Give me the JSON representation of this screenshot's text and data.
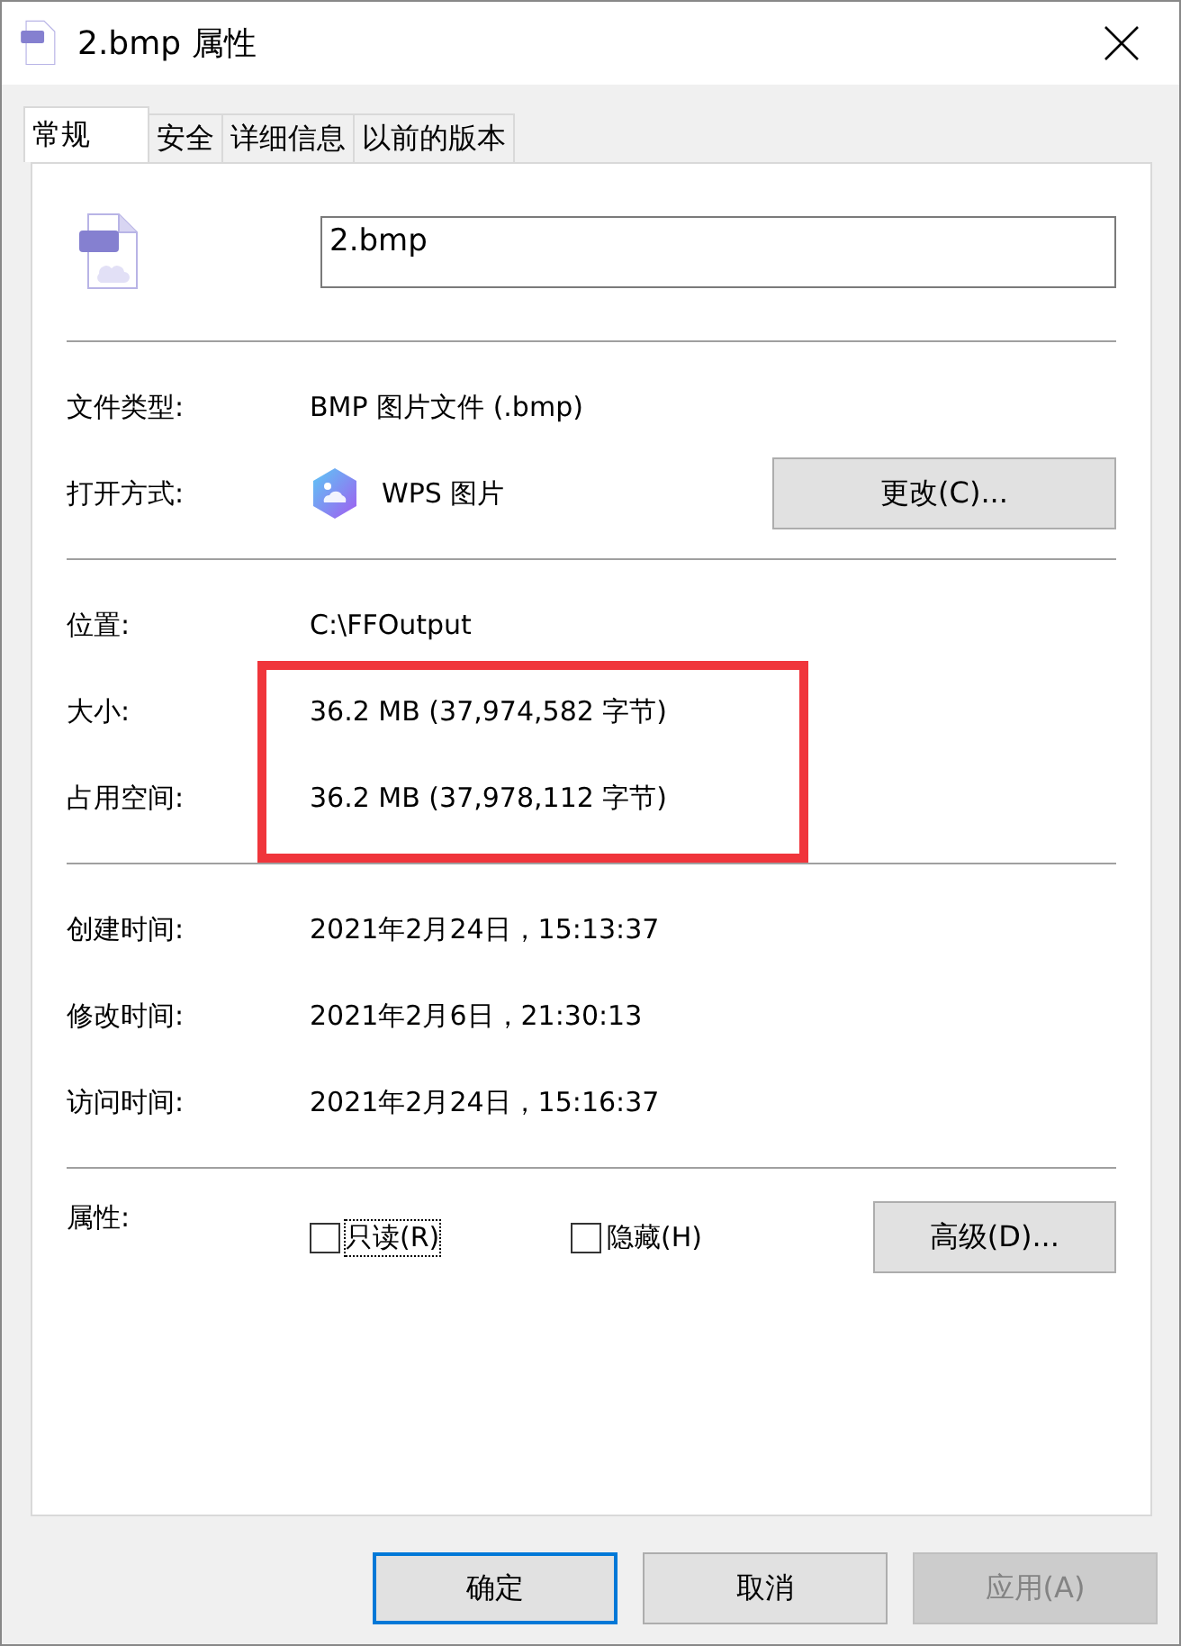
{
  "window": {
    "title": "2.bmp 属性"
  },
  "tabs": [
    {
      "label": "常规",
      "selected": true
    },
    {
      "label": "安全",
      "selected": false
    },
    {
      "label": "详细信息",
      "selected": false
    },
    {
      "label": "以前的版本",
      "selected": false
    }
  ],
  "name_field": {
    "value": "2.bmp"
  },
  "type_section": [
    {
      "label": "文件类型:",
      "value": "BMP 图片文件 (.bmp)"
    },
    {
      "label": "打开方式:",
      "value": "WPS 图片",
      "button": "更改(C)..."
    }
  ],
  "location": {
    "label": "位置:",
    "value": "C:\\FFOutput"
  },
  "size_group": {
    "highlighted": true,
    "rows": [
      {
        "label": "大小:",
        "value": "36.2 MB (37,974,582 字节)"
      },
      {
        "label": "占用空间:",
        "value": "36.2 MB (37,978,112 字节)"
      }
    ]
  },
  "times": [
    {
      "label": "创建时间:",
      "value": "2021年2月24日，15:13:37"
    },
    {
      "label": "修改时间:",
      "value": "2021年2月6日，21:30:13"
    },
    {
      "label": "访问时间:",
      "value": "2021年2月24日，15:16:37"
    }
  ],
  "attributes": {
    "label": "属性:",
    "checkboxes": [
      {
        "label": "只读(R)",
        "checked": false,
        "focused": true
      },
      {
        "label": "隐藏(H)",
        "checked": false,
        "focused": false
      }
    ],
    "button": "高级(D)..."
  },
  "buttons": [
    {
      "label": "确定",
      "default": true,
      "disabled": false
    },
    {
      "label": "取消",
      "default": false,
      "disabled": false
    },
    {
      "label": "应用(A)",
      "default": false,
      "disabled": true
    }
  ]
}
